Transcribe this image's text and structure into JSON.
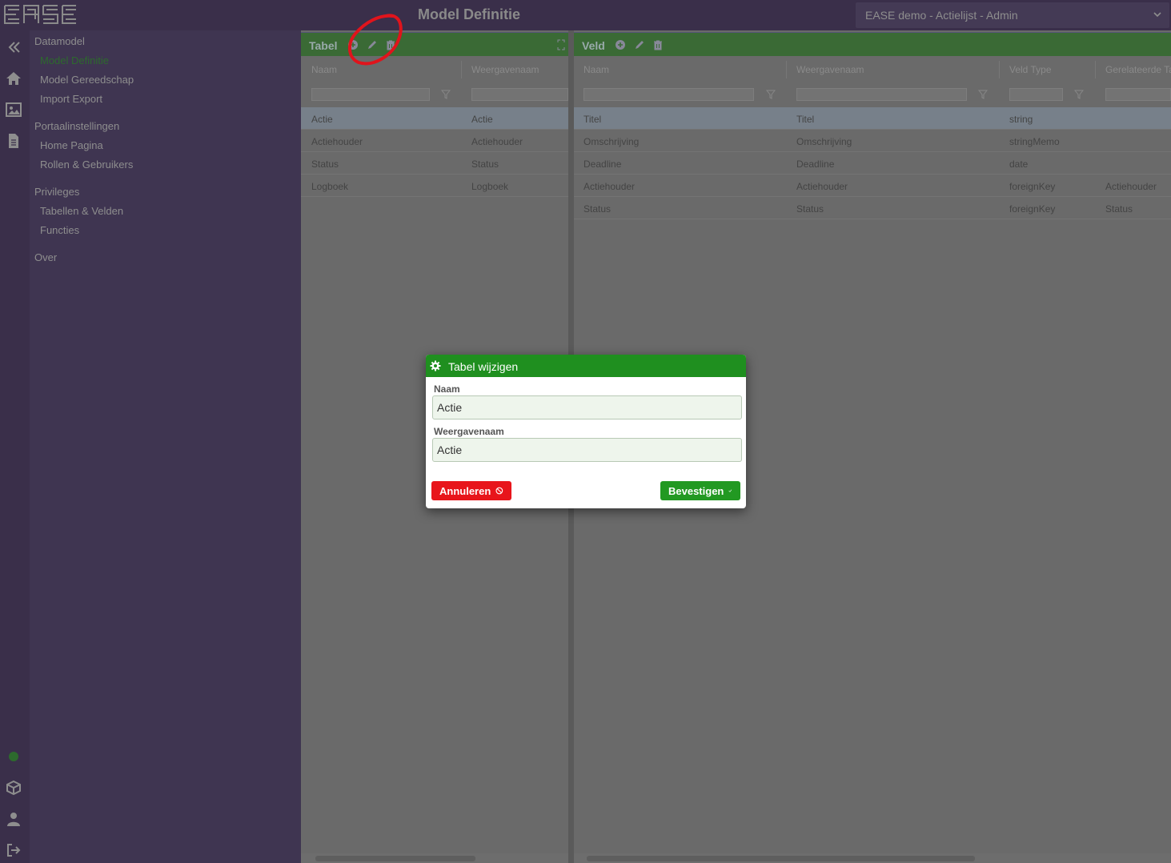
{
  "header": {
    "page_title": "Model Definitie",
    "app_select": "EASE demo - Actielijst - Admin",
    "logo_text": "EASE"
  },
  "sidebar": {
    "groups": [
      {
        "label": "Datamodel",
        "items": [
          "Model Definitie",
          "Model Gereedschap",
          "Import Export"
        ]
      },
      {
        "label": "Portaalinstellingen",
        "items": [
          "Home Pagina",
          "Rollen & Gebruikers"
        ]
      },
      {
        "label": "Privileges",
        "items": [
          "Tabellen & Velden",
          "Functies"
        ]
      },
      {
        "label": "Over",
        "items": []
      }
    ],
    "active_item": "Model Definitie"
  },
  "rail_icons": [
    "collapse-icon",
    "home-icon",
    "image-icon",
    "document-icon",
    "status-dot-icon",
    "package-icon",
    "user-icon",
    "logout-icon"
  ],
  "table_panel": {
    "title": "Tabel",
    "columns": [
      "Naam",
      "Weergavenaam"
    ],
    "rows": [
      [
        "Actie",
        "Actie"
      ],
      [
        "Actiehouder",
        "Actiehouder"
      ],
      [
        "Status",
        "Status"
      ],
      [
        "Logboek",
        "Logboek"
      ]
    ],
    "selected_row": 0
  },
  "field_panel": {
    "title": "Veld",
    "columns": [
      "Naam",
      "Weergavenaam",
      "Veld Type",
      "Gerelateerde Ta"
    ],
    "rows": [
      [
        "Titel",
        "Titel",
        "string",
        ""
      ],
      [
        "Omschrijving",
        "Omschrijving",
        "stringMemo",
        ""
      ],
      [
        "Deadline",
        "Deadline",
        "date",
        ""
      ],
      [
        "Actiehouder",
        "Actiehouder",
        "foreignKey",
        "Actiehouder"
      ],
      [
        "Status",
        "Status",
        "foreignKey",
        "Status"
      ]
    ],
    "selected_row": 0
  },
  "modal": {
    "title": "Tabel wijzigen",
    "naam_label": "Naam",
    "naam_value": "Actie",
    "weergavenaam_label": "Weergavenaam",
    "weergavenaam_value": "Actie",
    "cancel_label": "Annuleren",
    "confirm_label": "Bevestigen"
  },
  "colors": {
    "header_green": "#1f8f1f",
    "cancel_red": "#e8151b",
    "confirm_green": "#229922",
    "annotation_red": "#e0141c"
  }
}
